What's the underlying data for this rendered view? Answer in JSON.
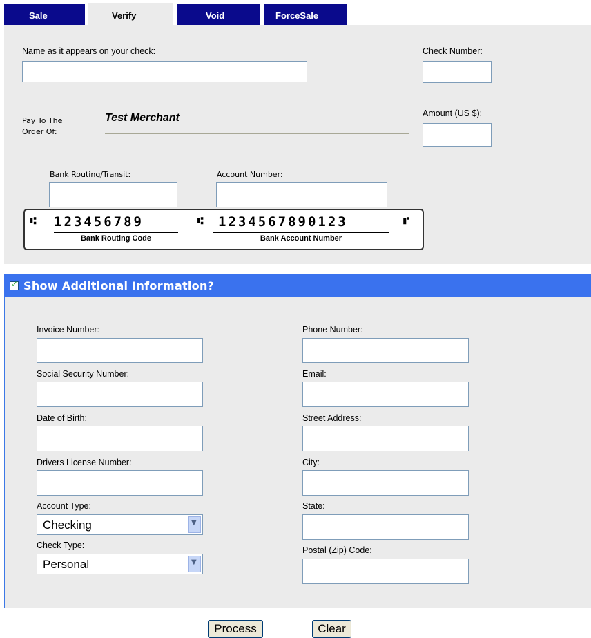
{
  "tabs": [
    {
      "label": "Sale"
    },
    {
      "label": "Verify"
    },
    {
      "label": "Void"
    },
    {
      "label": "ForceSale"
    }
  ],
  "check": {
    "name_label": "Name as it appears on your check:",
    "check_number_label": "Check Number:",
    "pay_to_line1": "Pay To The",
    "pay_to_line2": "Order Of:",
    "merchant": "Test Merchant",
    "amount_label": "Amount (US $):",
    "routing_label": "Bank Routing/Transit:",
    "account_label": "Account Number:",
    "micr_routing": "123456789",
    "micr_account": "1234567890123",
    "routing_caption": "Bank Routing Code",
    "account_caption": "Bank Account Number"
  },
  "additional": {
    "title": "Show Additional Information?",
    "checked": true,
    "left_fields": [
      {
        "label": "Invoice Number:"
      },
      {
        "label": "Social Security Number:"
      },
      {
        "label": "Date of Birth:"
      },
      {
        "label": "Drivers License Number:"
      }
    ],
    "account_type_label": "Account Type:",
    "account_type_value": "Checking",
    "check_type_label": "Check Type:",
    "check_type_value": "Personal",
    "right_fields": [
      {
        "label": "Phone Number:"
      },
      {
        "label": "Email:"
      },
      {
        "label": "Street Address:"
      },
      {
        "label": "City:"
      },
      {
        "label": "State:"
      },
      {
        "label": "Postal (Zip) Code:"
      }
    ]
  },
  "buttons": {
    "process": "Process",
    "clear": "Clear"
  }
}
